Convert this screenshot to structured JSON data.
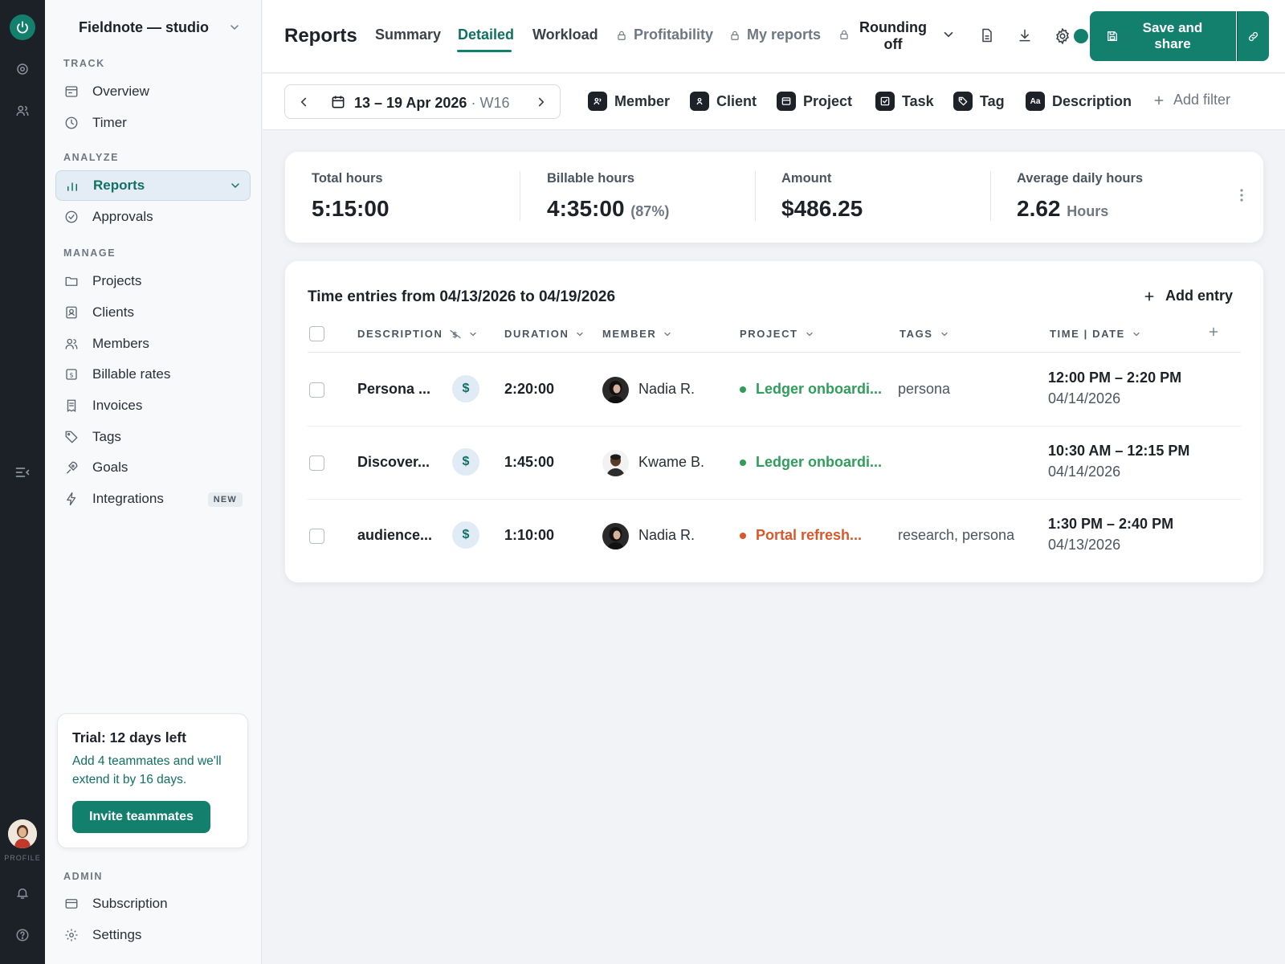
{
  "workspace": {
    "name": "Fieldnote — studio"
  },
  "rail": {
    "profile_label": "PROFILE"
  },
  "sidebar": {
    "sections": {
      "track": "TRACK",
      "analyze": "ANALYZE",
      "manage": "MANAGE",
      "admin": "ADMIN"
    },
    "items": {
      "overview": "Overview",
      "timer": "Timer",
      "reports": "Reports",
      "approvals": "Approvals",
      "projects": "Projects",
      "clients": "Clients",
      "members": "Members",
      "billable_rates": "Billable rates",
      "invoices": "Invoices",
      "tags": "Tags",
      "goals": "Goals",
      "integrations": "Integrations",
      "subscription": "Subscription",
      "settings": "Settings"
    },
    "integrations_badge": "NEW",
    "trial": {
      "title": "Trial: 12 days left",
      "body": "Add 4 teammates and we'll extend it by 16 days.",
      "button": "Invite teammates"
    }
  },
  "header": {
    "title": "Reports",
    "tabs": {
      "summary": "Summary",
      "detailed": "Detailed",
      "workload": "Workload",
      "profitability": "Profitability",
      "my_reports": "My reports"
    },
    "rounding_line1": "Rounding",
    "rounding_line2": "off",
    "save_line1": "Save and",
    "save_line2": "share"
  },
  "filters": {
    "date_range": "13 – 19 Apr 2026",
    "week": "· W16",
    "chips": {
      "member": "Member",
      "client": "Client",
      "project": "Project",
      "task": "Task",
      "tag": "Tag",
      "description": "Description"
    },
    "add_filter": "Add filter"
  },
  "summary": {
    "total_hours": {
      "label": "Total hours",
      "value": "5:15:00"
    },
    "billable_hours": {
      "label": "Billable hours",
      "value": "4:35:00",
      "sub": "(87%)"
    },
    "amount": {
      "label": "Amount",
      "value": "$486.25"
    },
    "avg_daily": {
      "label": "Average daily hours",
      "value": "2.62",
      "sub": "Hours"
    }
  },
  "entries": {
    "title": "Time entries from 04/13/2026 to 04/19/2026",
    "add_entry": "Add entry",
    "columns": {
      "description": "DESCRIPTION",
      "duration": "DURATION",
      "member": "MEMBER",
      "project": "PROJECT",
      "tags": "TAGS",
      "time_date": "TIME | DATE"
    },
    "billable_symbol": "$",
    "rows": [
      {
        "description": "Persona ...",
        "duration": "2:20:00",
        "member": "Nadia R.",
        "project": "Ledger onboardi...",
        "project_color": "#2f9e5b",
        "tags": "persona",
        "time": "12:00 PM – 2:20 PM",
        "date": "04/14/2026"
      },
      {
        "description": "Discover...",
        "duration": "1:45:00",
        "member": "Kwame B.",
        "project": "Ledger onboardi...",
        "project_color": "#2f9e5b",
        "tags": "",
        "time": "10:30 AM – 12:15 PM",
        "date": "04/14/2026"
      },
      {
        "description": "audience...",
        "duration": "1:10:00",
        "member": "Nadia R.",
        "project": "Portal refresh...",
        "project_color": "#d9572b",
        "tags": "research, persona",
        "time": "1:30 PM – 2:40 PM",
        "date": "04/13/2026"
      }
    ]
  }
}
